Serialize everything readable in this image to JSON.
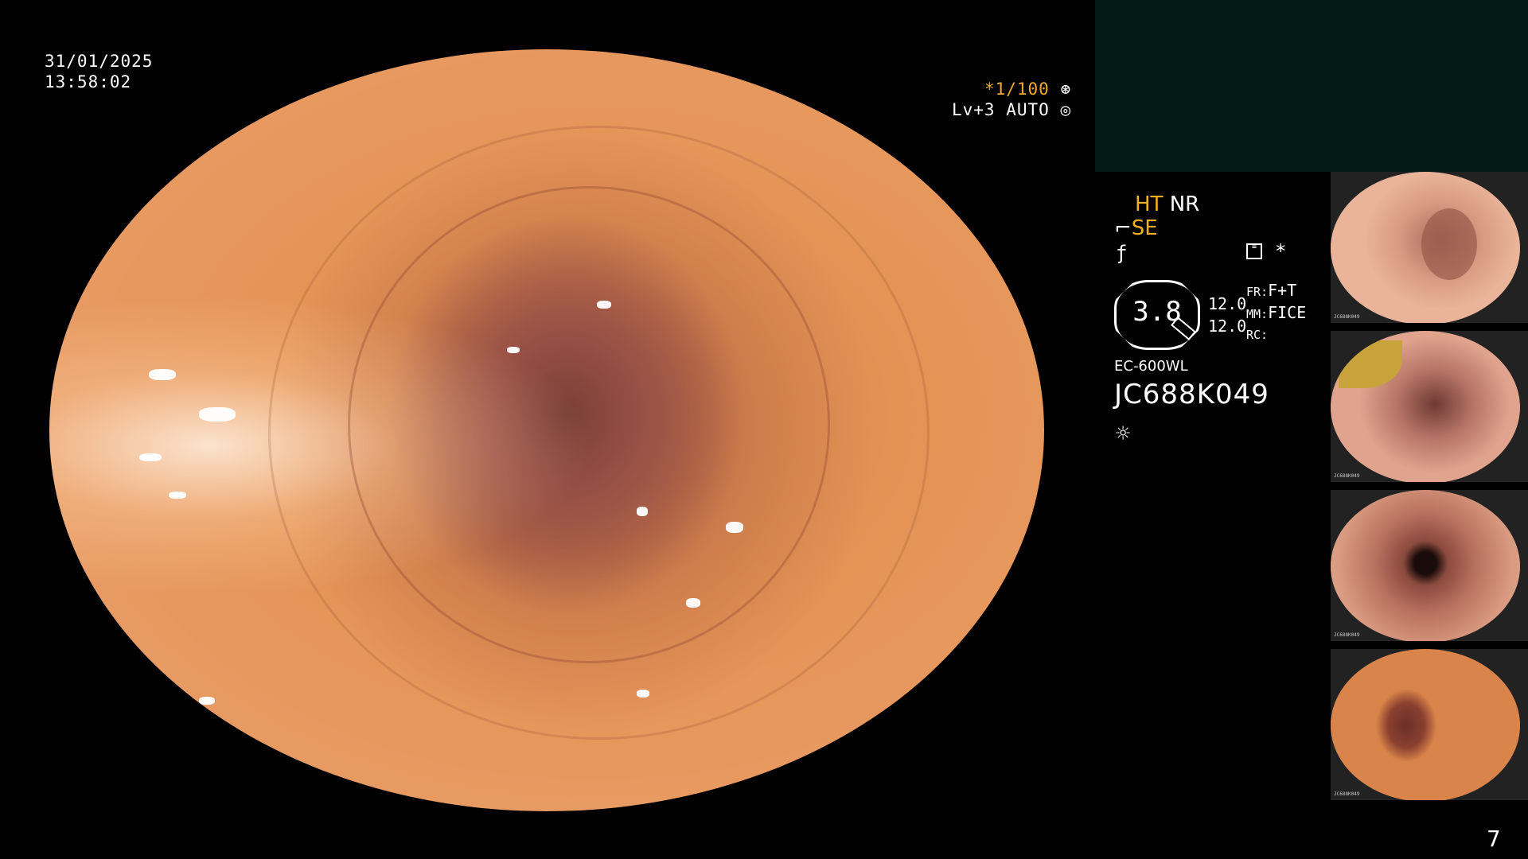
{
  "overlay": {
    "date": "31/01/2025",
    "time": "13:58:02",
    "shutter": "*1/100",
    "shutter_icon": "aperture-icon",
    "level": "Lv+3 AUTO",
    "level_icon": "iris-icon"
  },
  "info": {
    "ht": "HT",
    "nr": "NR",
    "se": "SE",
    "se_prefix_icon": "structure-enhance-icon",
    "function_icon": "function-icon",
    "menu_icon": "menu-icon",
    "star": "*",
    "zoom": "3.8",
    "value1": "12.0",
    "value2": "12.0",
    "fr_label": "FR:",
    "fr_value": "F+T",
    "mm_label": "MM:",
    "mm_value": "FICE",
    "rc_label": "RC:",
    "scope_model": "EC-600WL",
    "serial": "JC688K049",
    "light_icon": "light-source-icon"
  },
  "thumbnails": [
    {
      "caption": "JC688K049"
    },
    {
      "caption": "JC688K049"
    },
    {
      "caption": "JC688K049"
    },
    {
      "caption": "JC688K049"
    }
  ],
  "page_number": "7",
  "colors": {
    "accent_yellow": "#f0b021",
    "panel_dark": "#031a17",
    "mucosa": "#e59456"
  }
}
